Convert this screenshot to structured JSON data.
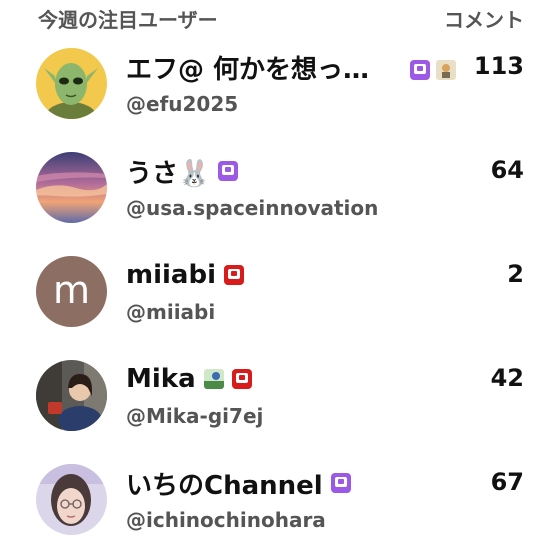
{
  "header": {
    "title": "今週の注目ユーザー",
    "count_label": "コメント"
  },
  "users": [
    {
      "name": "エフ@ 何かを想っ…",
      "handle": "@efu2025",
      "count": "113",
      "badge": "purple",
      "extra": "thumbnail",
      "avatar": "green-alien-avatar"
    },
    {
      "name": "うさ🐰",
      "handle": "@usa.spaceinnovation",
      "count": "64",
      "badge": "purple",
      "avatar": "sunset-sky-avatar"
    },
    {
      "name": "miiabi",
      "handle": "@miiabi",
      "count": "2",
      "badge": "red",
      "avatar": "letter-avatar",
      "avatar_letter": "m"
    },
    {
      "name": "Mika",
      "handle": "@Mika-gi7ej",
      "count": "42",
      "badge": "red",
      "extra": "thumbnail",
      "avatar": "photo-avatar"
    },
    {
      "name": "いちのChannel",
      "handle": "@ichinochinohara",
      "count": "67",
      "badge": "purple",
      "avatar": "portrait-avatar"
    }
  ],
  "colors": {
    "badge_purple": "#9b59e6",
    "badge_red": "#d81b1b",
    "letter_avatar_bg": "#8d6e63"
  }
}
